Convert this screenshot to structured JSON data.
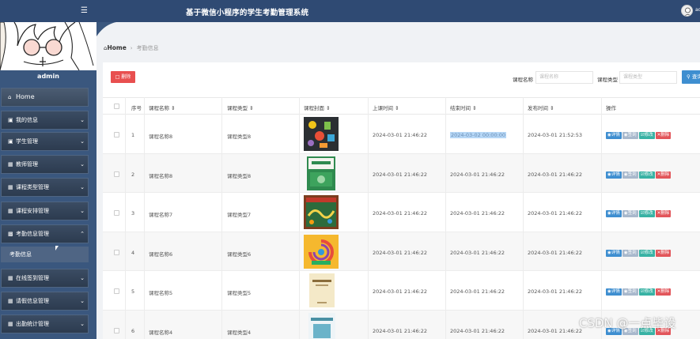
{
  "app": {
    "title": "基于微信小程序的学生考勤管理系统",
    "user": "admin"
  },
  "sidebar": {
    "username": "admin",
    "items": [
      {
        "label": "Home",
        "icon": "home-icon"
      },
      {
        "label": "我的信息",
        "icon": "id-card-icon"
      },
      {
        "label": "学生管理",
        "icon": "monitor-icon"
      },
      {
        "label": "教师管理",
        "icon": "grid-icon"
      },
      {
        "label": "课程类型管理",
        "icon": "grid-icon"
      },
      {
        "label": "课程安排管理",
        "icon": "grid-icon"
      },
      {
        "label": "考勤信息管理",
        "icon": "file-icon",
        "expanded": true
      },
      {
        "label": "在线签到管理",
        "icon": "grid-icon"
      },
      {
        "label": "请假信息管理",
        "icon": "grid-icon"
      },
      {
        "label": "出勤统计管理",
        "icon": "grid-icon"
      }
    ],
    "subitem": "考勤信息"
  },
  "breadcrumb": {
    "home": "Home",
    "current": "考勤信息"
  },
  "toolbar": {
    "delete_label": "删除",
    "course_name_label": "课程名称",
    "course_name_placeholder": "课程名称",
    "course_type_label": "课程类型",
    "course_type_placeholder": "课程类型",
    "search_label": "查询"
  },
  "table": {
    "headers": [
      "序号",
      "课程名称",
      "课程类型",
      "课程封面",
      "上课时间",
      "结束时间",
      "发布时间",
      "操作"
    ],
    "rows": [
      {
        "no": "1",
        "name": "课程名称8",
        "type": "课程类型8",
        "start": "2024-03-01 21:46:22",
        "end": "2024-03-02 00:00:00",
        "published": "2024-03-01 21:52:53",
        "end_highlighted": true
      },
      {
        "no": "2",
        "name": "课程名称8",
        "type": "课程类型8",
        "start": "2024-03-01 21:46:22",
        "end": "2024-03-01 21:46:22",
        "published": "2024-03-01 21:46:22"
      },
      {
        "no": "3",
        "name": "课程名称7",
        "type": "课程类型7",
        "start": "2024-03-01 21:46:22",
        "end": "2024-03-01 21:46:22",
        "published": "2024-03-01 21:46:22"
      },
      {
        "no": "4",
        "name": "课程名称6",
        "type": "课程类型6",
        "start": "2024-03-01 21:46:22",
        "end": "2024-03-01 21:46:22",
        "published": "2024-03-01 21:46:22"
      },
      {
        "no": "5",
        "name": "课程名称5",
        "type": "课程类型5",
        "start": "2024-03-01 21:46:22",
        "end": "2024-03-01 21:46:22",
        "published": "2024-03-01 21:46:22"
      },
      {
        "no": "6",
        "name": "课程名称4",
        "type": "课程类型4",
        "start": "2024-03-01 21:46:22",
        "end": "2024-03-01 21:46:22",
        "published": "2024-03-01 21:46:22"
      }
    ],
    "actions": {
      "detail": "详情",
      "sign": "签到",
      "edit": "修改",
      "delete": "删除"
    }
  },
  "watermark": "CSDN @一点毕设",
  "colors": {
    "topbar": "#2f4a73",
    "sidebar": "#3a577e",
    "primary": "#3e8ed0",
    "danger": "#e84f4f",
    "success": "#38b2a4"
  }
}
